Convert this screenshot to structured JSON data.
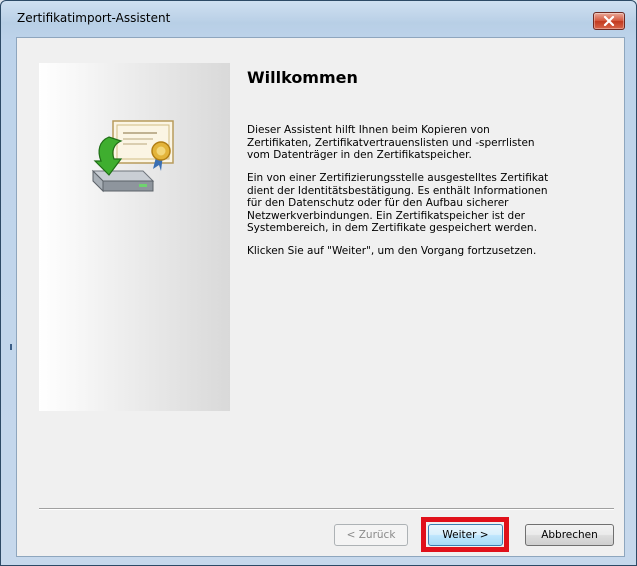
{
  "window": {
    "title": "Zertifikatimport-Assistent",
    "close_icon": "close-icon"
  },
  "wizard": {
    "illustration_icon": "certificate-import-icon",
    "heading": "Willkommen",
    "paragraph1": "Dieser Assistent hilft Ihnen beim Kopieren von\nZertifikaten, Zertifikatvertrauenslisten und -sperrlisten\nvom Datenträger in den Zertifikatspeicher.",
    "paragraph2": "Ein von einer Zertifizierungsstelle ausgestelltes Zertifikat\ndient der Identitätsbestätigung. Es enthält Informationen\nfür den Datenschutz oder für den Aufbau sicherer\nNetzwerkverbindungen. Ein Zertifikatspeicher ist der\nSystembereich, in dem Zertifikate gespeichert werden.",
    "paragraph3": "Klicken Sie auf \"Weiter\", um den Vorgang fortzusetzen."
  },
  "buttons": {
    "back": "< Zurück",
    "next": "Weiter >",
    "cancel": "Abbrechen"
  },
  "colors": {
    "highlight": "#e0101a",
    "close_button": "#c23a1f"
  }
}
